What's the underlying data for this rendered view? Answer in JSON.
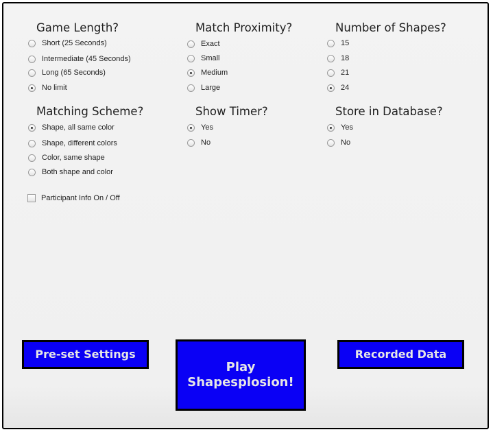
{
  "groups": [
    {
      "title": "Game Length?",
      "options": [
        {
          "label": "Short (25 Seconds)",
          "checked": false
        },
        {
          "label": "Intermediate (45 Seconds)",
          "checked": false
        },
        {
          "label": "Long (65 Seconds)",
          "checked": false
        },
        {
          "label": "No limit",
          "checked": true
        }
      ]
    },
    {
      "title": "Match Proximity?",
      "options": [
        {
          "label": "Exact",
          "checked": false
        },
        {
          "label": "Small",
          "checked": false
        },
        {
          "label": "Medium",
          "checked": true
        },
        {
          "label": "Large",
          "checked": false
        }
      ]
    },
    {
      "title": "Number of Shapes?",
      "options": [
        {
          "label": "15",
          "checked": false
        },
        {
          "label": "18",
          "checked": false
        },
        {
          "label": "21",
          "checked": false
        },
        {
          "label": "24",
          "checked": true
        }
      ]
    },
    {
      "title": "Matching Scheme?",
      "options": [
        {
          "label": "Shape, all same color",
          "checked": true
        },
        {
          "label": "Shape, different colors",
          "checked": false
        },
        {
          "label": "Color, same shape",
          "checked": false
        },
        {
          "label": "Both shape and color",
          "checked": false
        }
      ]
    },
    {
      "title": "Show Timer?",
      "options": [
        {
          "label": "Yes",
          "checked": true
        },
        {
          "label": "No",
          "checked": false
        }
      ]
    },
    {
      "title": "Store in Database?",
      "options": [
        {
          "label": "Yes",
          "checked": true
        },
        {
          "label": "No",
          "checked": false
        }
      ]
    }
  ],
  "participant_info": {
    "label": "Participant Info On / Off",
    "checked": false
  },
  "buttons": {
    "preset": "Pre-set Settings",
    "play": "Play Shapesplosion!",
    "recorded": "Recorded Data"
  },
  "colors": {
    "button_bg": "#0a00f5",
    "button_text": "#e6e6e6",
    "button_border": "#000000"
  }
}
